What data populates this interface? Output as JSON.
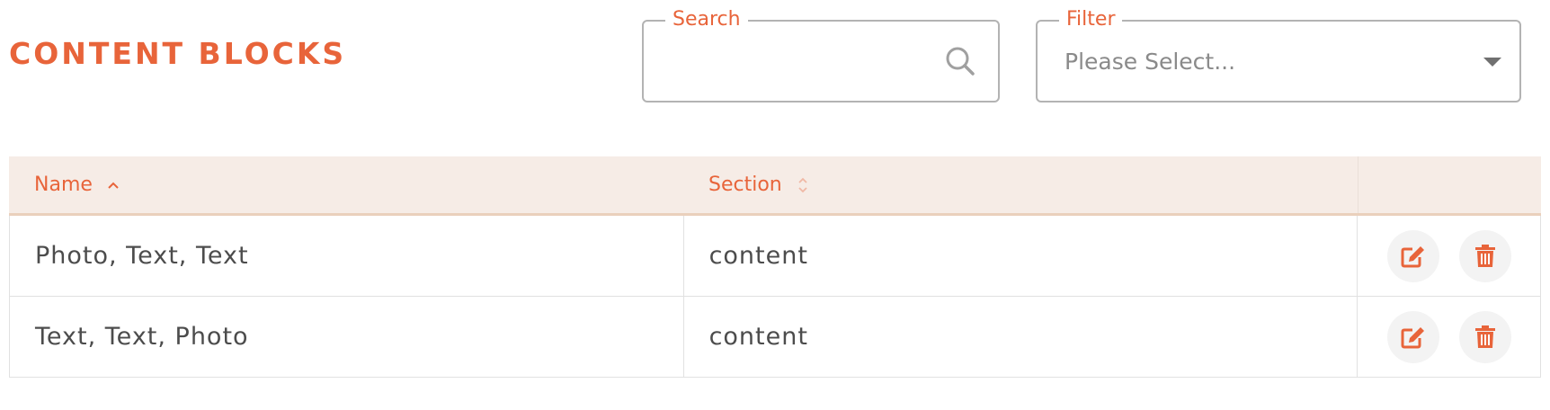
{
  "header": {
    "title": "CONTENT BLOCKS"
  },
  "search": {
    "label": "Search",
    "value": "",
    "placeholder": "",
    "icon": "search-icon"
  },
  "filter": {
    "label": "Filter",
    "selected": "Please Select...",
    "icon": "chevron-down-icon"
  },
  "table": {
    "columns": [
      {
        "label": "Name",
        "sort": "ascending",
        "sort_icon": "sort-ascending-icon"
      },
      {
        "label": "Section",
        "sort": "none",
        "sort_icon": "sort-both-icon"
      }
    ],
    "rows": [
      {
        "name": "Photo, Text, Text",
        "section": "content"
      },
      {
        "name": "Text, Text, Photo",
        "section": "content"
      }
    ],
    "row_actions": [
      "edit-icon",
      "trash-icon"
    ]
  },
  "colors": {
    "accent": "#e8643a",
    "header_background": "#f6ece6",
    "border": "#e1e1e1",
    "text": "#4c4c4c",
    "action_button_background": "#f3f3f3"
  }
}
